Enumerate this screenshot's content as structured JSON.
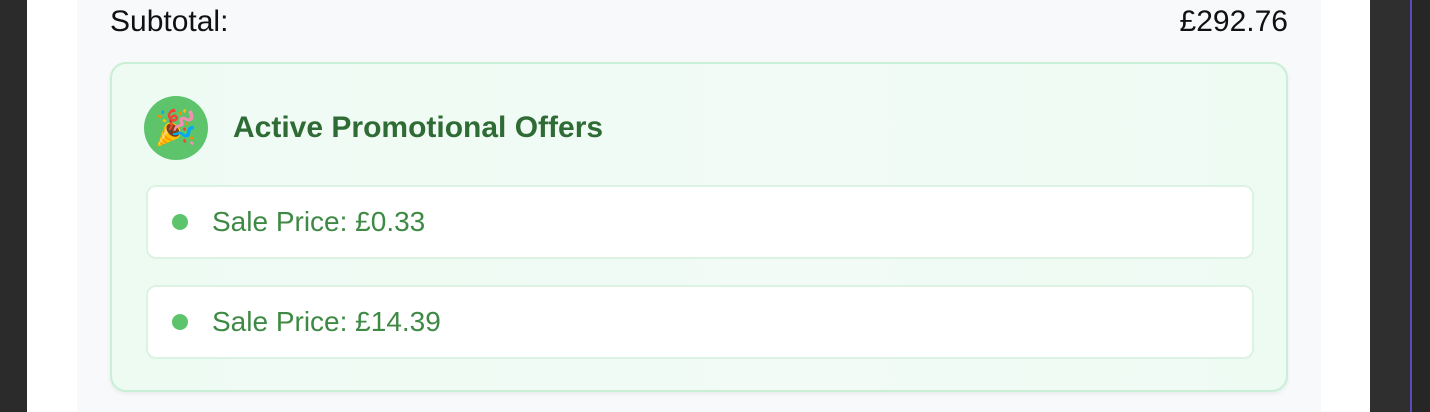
{
  "summary": {
    "subtotal_label": "Subtotal:",
    "subtotal_value": "£292.76"
  },
  "promotions": {
    "icon": "party-popper-icon",
    "title": "Active Promotional Offers",
    "offers": [
      {
        "label": "Sale Price: £0.33"
      },
      {
        "label": "Sale Price: £14.39"
      }
    ]
  },
  "colors": {
    "accent_green": "#5ec46c",
    "title_green": "#2f6b35",
    "offer_text_green": "#3e8a45",
    "card_background": "#eefbf3",
    "card_border": "#c9efd6"
  }
}
